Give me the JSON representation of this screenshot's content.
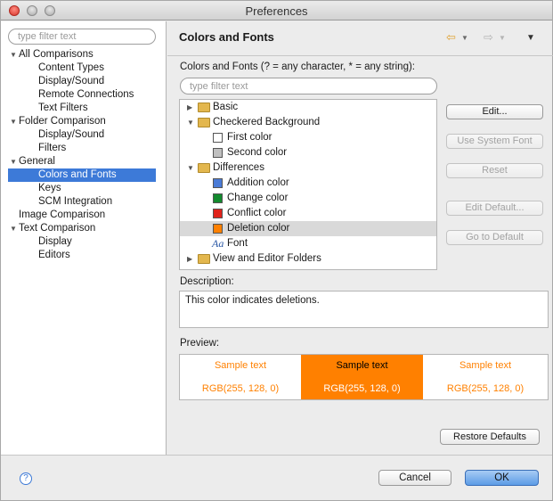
{
  "window": {
    "title": "Preferences"
  },
  "left": {
    "filter_placeholder": "type filter text",
    "tree": [
      {
        "label": "All Comparisons",
        "level": 0,
        "expanded": true
      },
      {
        "label": "Content Types",
        "level": 1
      },
      {
        "label": "Display/Sound",
        "level": 1
      },
      {
        "label": "Remote Connections",
        "level": 1
      },
      {
        "label": "Text Filters",
        "level": 1
      },
      {
        "label": "Folder Comparison",
        "level": 0,
        "expanded": true
      },
      {
        "label": "Display/Sound",
        "level": 1
      },
      {
        "label": "Filters",
        "level": 1
      },
      {
        "label": "General",
        "level": 0,
        "expanded": true
      },
      {
        "label": "Colors and Fonts",
        "level": 1,
        "selected": true
      },
      {
        "label": "Keys",
        "level": 1
      },
      {
        "label": "SCM Integration",
        "level": 1
      },
      {
        "label": "Image Comparison",
        "level": 0
      },
      {
        "label": "Text Comparison",
        "level": 0,
        "expanded": true
      },
      {
        "label": "Display",
        "level": 1
      },
      {
        "label": "Editors",
        "level": 1
      }
    ]
  },
  "right": {
    "title": "Colors and Fonts",
    "nav_back_icon": "arrow-left-icon",
    "nav_forward_icon": "arrow-right-icon",
    "menu_icon": "triangle-down-icon",
    "list_label": "Colors and Fonts (? = any character, * = any string):",
    "filter_placeholder": "type filter text",
    "tree": {
      "basic": "Basic",
      "checkered": "Checkered Background",
      "first_color": "First color",
      "second_color": "Second color",
      "differences": "Differences",
      "addition": "Addition color",
      "change": "Change color",
      "conflict": "Conflict color",
      "deletion": "Deletion color",
      "font": "Font",
      "font_icon_text": "Aa",
      "view_editor": "View and Editor Folders"
    },
    "swatch_colors": {
      "first": "#ffffff",
      "second": "#c0c0c0",
      "addition": "#4a7bd6",
      "change": "#138a2e",
      "conflict": "#e0231b",
      "deletion": "#ff8000"
    },
    "buttons": {
      "edit": "Edit...",
      "use_system_font": "Use System Font",
      "reset": "Reset",
      "edit_default": "Edit Default...",
      "go_to_default": "Go to Default",
      "restore_defaults": "Restore Defaults"
    },
    "description_label": "Description:",
    "description": "This color indicates deletions.",
    "preview_label": "Preview:",
    "preview": [
      {
        "text": "Sample text",
        "rgb": "RGB(255, 128, 0)",
        "bg": "#ffffff",
        "fg": "#ff8000"
      },
      {
        "text": "Sample text",
        "rgb": "RGB(255, 128, 0)",
        "bg": "#ff8000",
        "fg": "#000000"
      },
      {
        "text": "Sample text",
        "rgb": "RGB(255, 128, 0)",
        "bg": "#ffffff",
        "fg": "#ff8000"
      }
    ]
  },
  "footer": {
    "help_icon": "help-icon",
    "help_glyph": "?",
    "cancel": "Cancel",
    "ok": "OK"
  }
}
